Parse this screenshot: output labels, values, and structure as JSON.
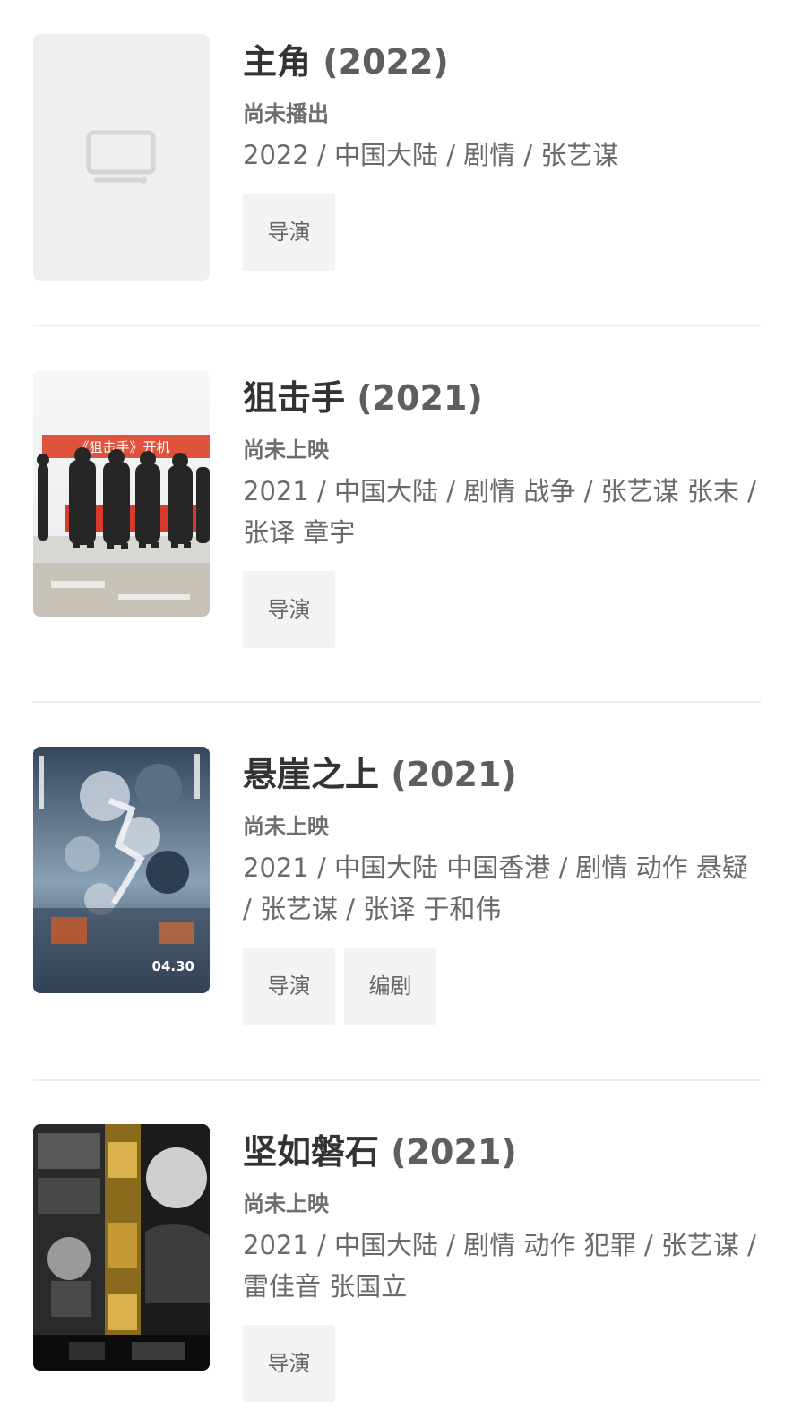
{
  "items": [
    {
      "title": "主角",
      "year": "(2022)",
      "status": "尚未播出",
      "meta": "2022 / 中国大陆 / 剧情 / 张艺谋",
      "roles": [
        "导演"
      ],
      "poster": "placeholder-tv-icon"
    },
    {
      "title": "狙击手",
      "year": "(2021)",
      "status": "尚未上映",
      "meta": "2021 / 中国大陆 / 剧情 战争 / 张艺谋 张末 / 张译 章宇",
      "roles": [
        "导演"
      ],
      "poster": "film-crew-snow-banner",
      "poster_banner_text": "《狙击手》开机"
    },
    {
      "title": "悬崖之上",
      "year": "(2021)",
      "status": "尚未上映",
      "meta": "2021 / 中国大陆 中国香港 / 剧情 动作 悬疑 / 张艺谋 / 张译 于和伟",
      "roles": [
        "导演",
        "编剧"
      ],
      "poster": "blue-snow-spy-poster",
      "poster_date": "04.30"
    },
    {
      "title": "坚如磐石",
      "year": "(2021)",
      "status": "尚未上映",
      "meta": "2021 / 中国大陆 / 剧情 动作 犯罪 / 张艺谋 / 雷佳音 张国立",
      "roles": [
        "导演"
      ],
      "poster": "black-white-director-collage"
    }
  ],
  "colors": {
    "title": "#333333",
    "meta": "#6a6a6a",
    "role_bg": "#f3f3f3",
    "divider": "#ececec",
    "placeholder_bg": "#efefef"
  }
}
